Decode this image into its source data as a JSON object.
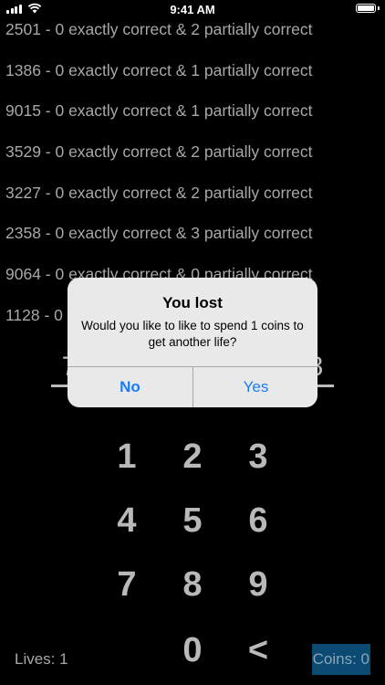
{
  "status_bar": {
    "time": "9:41 AM",
    "signal_icon": "cellular-signal-icon",
    "wifi_icon": "wifi-icon",
    "battery_icon": "battery-icon",
    "battery_level": 1.0
  },
  "guesses": [
    "2501 - 0 exactly correct & 2 partially correct",
    "1386 - 0 exactly correct & 1 partially correct",
    "9015 - 0 exactly correct & 1 partially correct",
    "3529 - 0 exactly correct & 2 partially correct",
    "3227 - 0 exactly correct & 2 partially correct",
    "2358 - 0 exactly correct & 3 partially correct",
    "9064 - 0 exactly correct & 0 partially correct",
    "1128 - 0"
  ],
  "input": {
    "slots": [
      "7",
      "",
      "",
      "8"
    ]
  },
  "keypad": {
    "keys": [
      "1",
      "2",
      "3",
      "4",
      "5",
      "6",
      "7",
      "8",
      "9",
      "0",
      "<"
    ]
  },
  "footer": {
    "lives": "Lives: 1",
    "coins": "Coins: 0"
  },
  "alert": {
    "title": "You lost",
    "message": "Would you like to like to spend 1 coins to get another life?",
    "no_label": "No",
    "yes_label": "Yes"
  },
  "colors": {
    "background": "#000000",
    "text": "#a8a8a8",
    "alert_bg": "#e9e9ea",
    "alert_button": "#1a7cf5",
    "coins_bg": "#0a4a73"
  }
}
